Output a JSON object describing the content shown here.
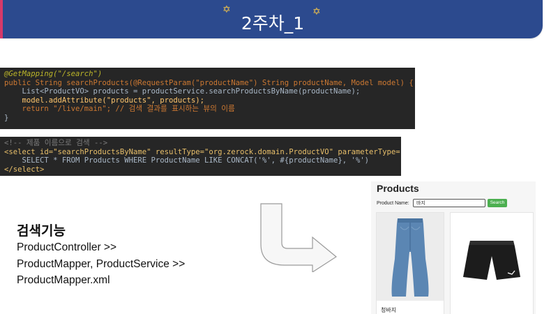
{
  "slide": {
    "title": "2주차_1",
    "star_glyph": "✡"
  },
  "code_controller": {
    "line1": "@GetMapping(\"/search\")",
    "line2": "public String searchProducts(@RequestParam(\"productName\") String productName, Model model) {",
    "line3": "    List<ProductVO> products = productService.searchProductsByName(productName);",
    "line4": "    model.addAttribute(\"products\", products);",
    "line5": "    return \"/live/main\"; // 검색 결과를 표시하는 뷰의 이름",
    "line6": "}"
  },
  "code_mapper": {
    "line1": "<!-- 제품 이름으로 검색 -->",
    "line2": "<select id=\"searchProductsByName\" resultType=\"org.zerock.domain.ProductVO\" parameterType=\"string\">",
    "line3": "    SELECT * FROM Products WHERE ProductName LIKE CONCAT('%', #{productName}, '%')",
    "line4": "</select>"
  },
  "feature": {
    "heading": "검색기능",
    "line1": "ProductController >>",
    "line2": "ProductMapper, ProductService >>",
    "line3": "ProductMapper.xml"
  },
  "products_page": {
    "title": "Products",
    "search_label": "Product Name:",
    "search_value": "바지",
    "search_button": "Search",
    "items": [
      {
        "name": "청바지"
      },
      {
        "name": ""
      }
    ]
  },
  "colors": {
    "banner": "#2c4a8e",
    "banner_accent": "#d63a6a",
    "code_bg": "#262626",
    "search_button": "#4caf50"
  }
}
